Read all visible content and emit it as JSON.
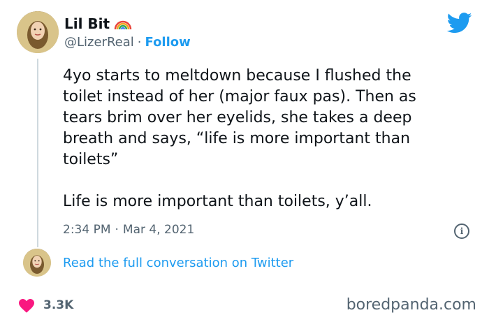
{
  "author": {
    "name": "Lil Bit",
    "handle": "@LizerReal",
    "separator": "·",
    "follow_label": "Follow",
    "name_badge_icon": "rainbow-icon"
  },
  "tweet": {
    "text": "4yo starts to meltdown because I flushed the\ntoilet instead of her (major faux pas). Then as\ntears brim over her eyelids, she takes a deep\nbreath and says, “life is more important than\ntoilets”\n\nLife is more important than toilets, y’all.",
    "time": "2:34 PM",
    "separator": "·",
    "date": "Mar 4, 2021"
  },
  "conversation_link": "Read the full conversation on Twitter",
  "engagement": {
    "likes": "3.3K",
    "like_icon": "heart-icon"
  },
  "watermark": "boredpanda.com",
  "colors": {
    "accent": "#1d9bf0",
    "heart": "#f91880",
    "text": "#0f1419",
    "muted": "#536471"
  },
  "icons": {
    "twitter": "twitter-bird-icon",
    "info": "info-icon"
  }
}
